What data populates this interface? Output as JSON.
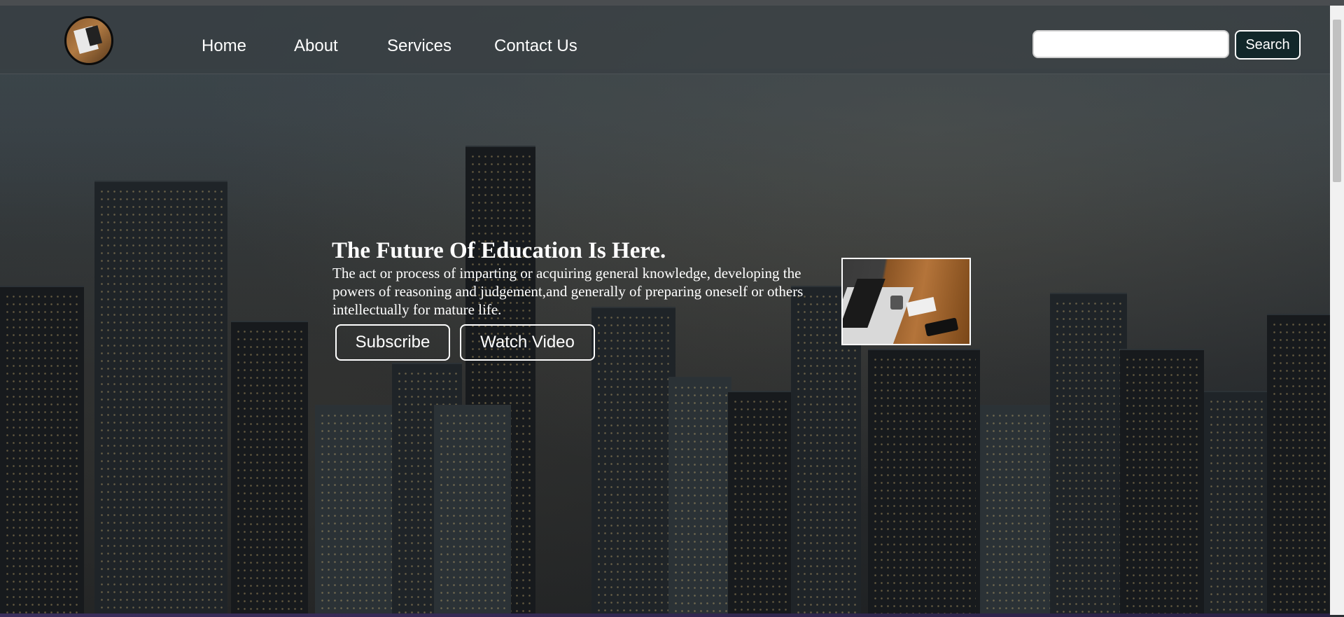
{
  "nav": {
    "logo_icon": "laptop-desk-logo",
    "links": [
      "Home",
      "About",
      "Services",
      "Contact Us"
    ],
    "search": {
      "placeholder": "",
      "value": "",
      "button_label": "Search"
    }
  },
  "hero": {
    "title": "The Future Of Education Is Here.",
    "description": "The act or process of imparting or acquiring general knowledge, developing the powers of reasoning and judgement,and generally of preparing oneself or others intellectually for mature life.",
    "buttons": {
      "subscribe": "Subscribe",
      "watch": "Watch Video"
    },
    "image_icon": "laptop-coffee-photo"
  },
  "colors": {
    "overlay": "#373e42",
    "search_button_bg": "#12272a",
    "text": "#ffffff"
  }
}
